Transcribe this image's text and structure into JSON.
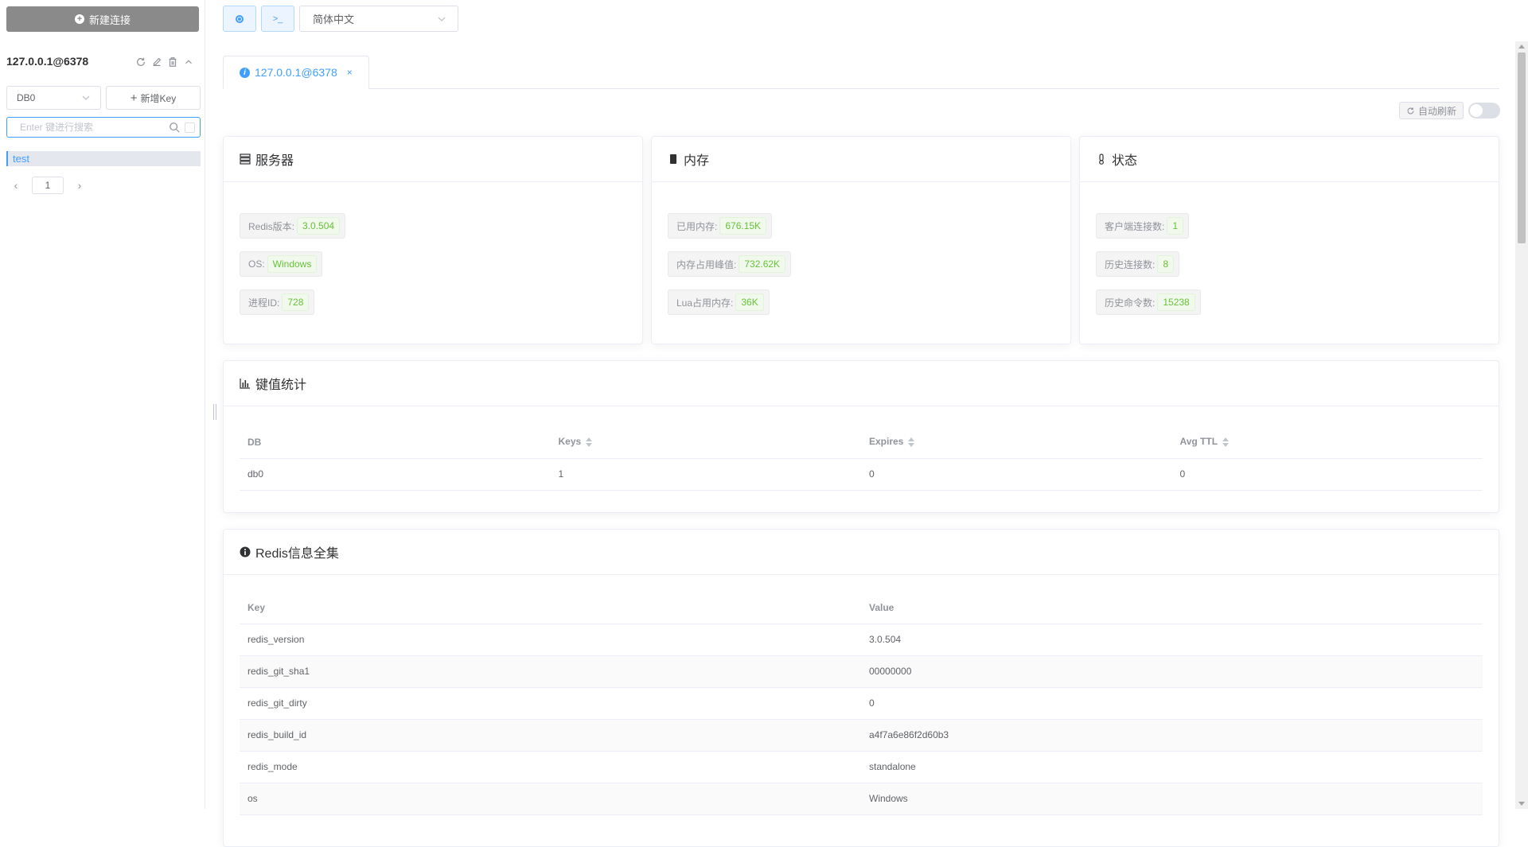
{
  "sidebar": {
    "new_connection_label": "新建连接",
    "connection_name": "127.0.0.1@6378",
    "db_select_value": "DB0",
    "add_key_label": "新增Key",
    "search_placeholder": "Enter 键进行搜索",
    "keys": [
      "test"
    ],
    "page_number": "1"
  },
  "topbar": {
    "status_icon": "dot-circle-icon",
    "terminal_icon": "terminal-icon",
    "terminal_glyph": ">_",
    "language_value": "简体中文"
  },
  "tab": {
    "label": "127.0.0.1@6378",
    "close": "×"
  },
  "auto_refresh_label": "自动刷新",
  "server": {
    "title": "服务器",
    "rows": [
      {
        "label": "Redis版本:",
        "value": "3.0.504"
      },
      {
        "label": "OS:",
        "value": "Windows"
      },
      {
        "label": "进程ID:",
        "value": "728"
      }
    ]
  },
  "memory": {
    "title": "内存",
    "rows": [
      {
        "label": "已用内存:",
        "value": "676.15K"
      },
      {
        "label": "内存占用峰值:",
        "value": "732.62K"
      },
      {
        "label": "Lua占用内存:",
        "value": "36K"
      }
    ]
  },
  "status": {
    "title": "状态",
    "rows": [
      {
        "label": "客户端连接数:",
        "value": "1"
      },
      {
        "label": "历史连接数:",
        "value": "8"
      },
      {
        "label": "历史命令数:",
        "value": "15238"
      }
    ]
  },
  "key_stats": {
    "title": "键值统计",
    "headers": [
      "DB",
      "Keys",
      "Expires",
      "Avg TTL"
    ],
    "rows": [
      [
        "db0",
        "1",
        "0",
        "0"
      ]
    ]
  },
  "redis_info": {
    "title": "Redis信息全集",
    "headers": [
      "Key",
      "Value"
    ],
    "rows": [
      [
        "redis_version",
        "3.0.504"
      ],
      [
        "redis_git_sha1",
        "00000000"
      ],
      [
        "redis_git_dirty",
        "0"
      ],
      [
        "redis_build_id",
        "a4f7a6e86f2d60b3"
      ],
      [
        "redis_mode",
        "standalone"
      ],
      [
        "os",
        "Windows"
      ]
    ]
  },
  "colors": {
    "accent": "#409eff",
    "success": "#67c23a",
    "new_conn_bg": "#8a8a8a"
  }
}
